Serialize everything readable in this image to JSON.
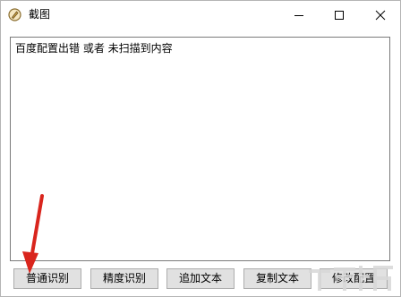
{
  "window": {
    "title": "截图"
  },
  "textarea": {
    "content": "百度配置出错 或者 未扫描到内容"
  },
  "buttons": {
    "normal_ocr": "普通识别",
    "precise_ocr": "精度识别",
    "append_text": "追加文本",
    "copy_text": "复制文本",
    "modify_config": "修改配置"
  },
  "icons": {
    "app": "pen-nib-icon",
    "minimize": "minimize-icon",
    "maximize": "maximize-icon",
    "close": "close-icon"
  },
  "colors": {
    "annotation_arrow": "#d9251d",
    "button_bg": "#e1e1e1",
    "button_border": "#adadad"
  }
}
